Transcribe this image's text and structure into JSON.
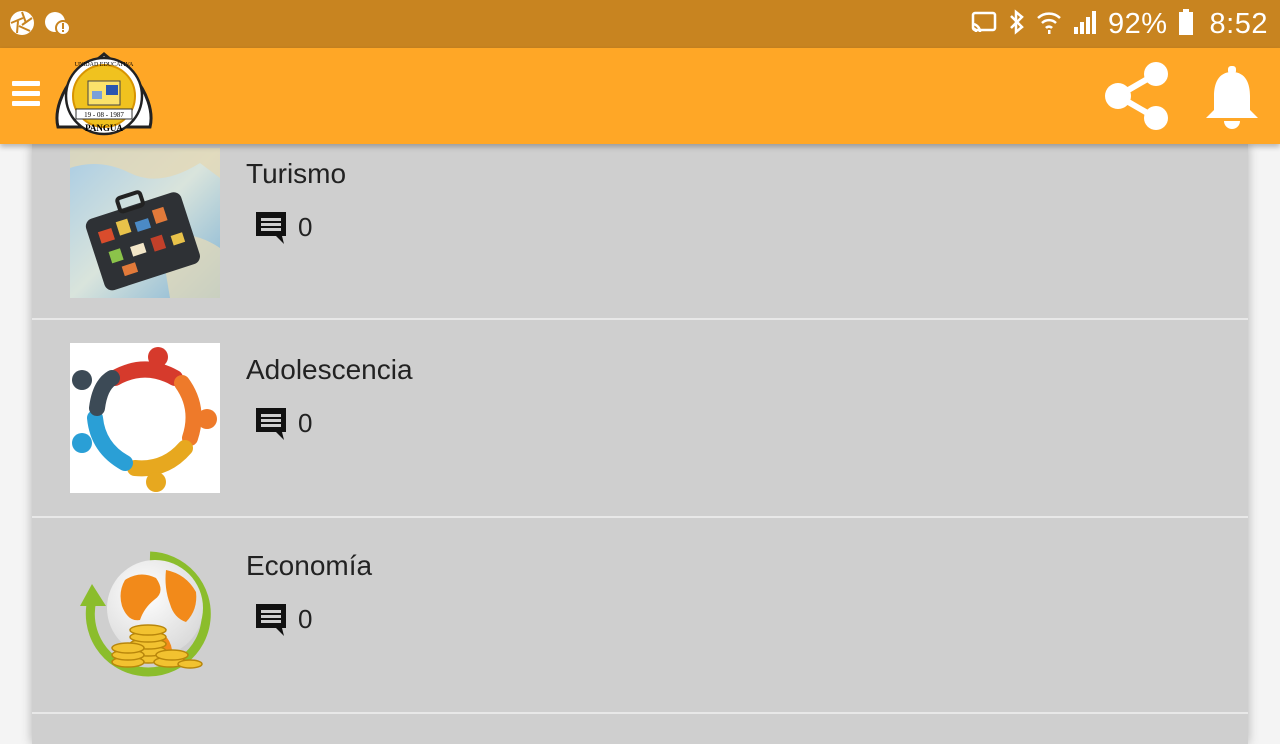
{
  "status_bar": {
    "battery_percent": "92%",
    "time": "8:52",
    "icons": [
      "aperture-icon",
      "cloud-alert-icon",
      "cast-icon",
      "bluetooth-icon",
      "wifi-icon",
      "signal-icon",
      "battery-icon"
    ]
  },
  "app_bar": {
    "background": "#ffa726",
    "logo": {
      "top_text": "UNIDAD EDUCATIVA",
      "date_text": "19 - 08 - 1987",
      "bottom_text": "PANGUA"
    },
    "actions": [
      "share-icon",
      "bell-icon"
    ]
  },
  "items": [
    {
      "title": "Turismo",
      "comments": "0",
      "image": "suitcase-on-map"
    },
    {
      "title": "Adolescencia",
      "comments": "0",
      "image": "people-circle"
    },
    {
      "title": "Economía",
      "comments": "0",
      "image": "globe-coins"
    }
  ]
}
